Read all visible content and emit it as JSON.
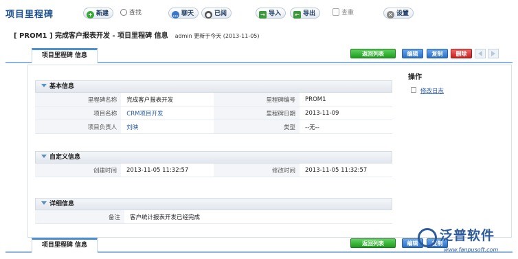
{
  "app": {
    "title": "项目里程碑"
  },
  "toolbar": {
    "new_label": "新建",
    "find_label": "查找",
    "chat_label": "聊天",
    "read_label": "已阅",
    "import_label": "导入",
    "export_label": "导出",
    "dedupe_label": "查重",
    "settings_label": "设置"
  },
  "record": {
    "title": "[ PROM1 ] 完成客户报表开发  - 项目里程碑  信息",
    "meta": "admin 更新于今天  (2013-11-05)"
  },
  "tabs": {
    "info_label": "项目里程碑  信息"
  },
  "actions": {
    "back_label": "返回列表",
    "edit_label": "编辑",
    "copy_label": "复制",
    "delete_label": "删除"
  },
  "sections": {
    "basic": {
      "title": "基本信息",
      "rows": [
        {
          "l1": "里程碑名称",
          "v1": "完成客户报表开发",
          "l2": "里程碑编号",
          "v2": "PROM1"
        },
        {
          "l1": "项目名称",
          "v1": "CRM项目开发",
          "l2": "里程碑日期",
          "v2": "2013-11-09"
        },
        {
          "l1": "项目负责人",
          "v1": "刘映",
          "l2": "类型",
          "v2": "--无--"
        }
      ]
    },
    "custom": {
      "title": "自定义信息",
      "rows": [
        {
          "l1": "创建时间",
          "v1": "2013-11-05 11:32:57",
          "l2": "修改时间",
          "v2": "2013-11-05 11:32:57"
        }
      ]
    },
    "detail": {
      "title": "详细信息",
      "rows": [
        {
          "l1": "备注",
          "v1": "客户统计报表开发已经完成"
        }
      ]
    }
  },
  "sidebar": {
    "title": "操作",
    "item_label": "修改日志"
  },
  "watermark": {
    "brand": "泛普软件",
    "url": "www.fanpusoft.com"
  },
  "colors": {
    "brand_blue": "#1a4e8c",
    "green_button": "#2aa52a",
    "blue_button": "#2c6ec2",
    "red_button": "#c81f1f"
  }
}
